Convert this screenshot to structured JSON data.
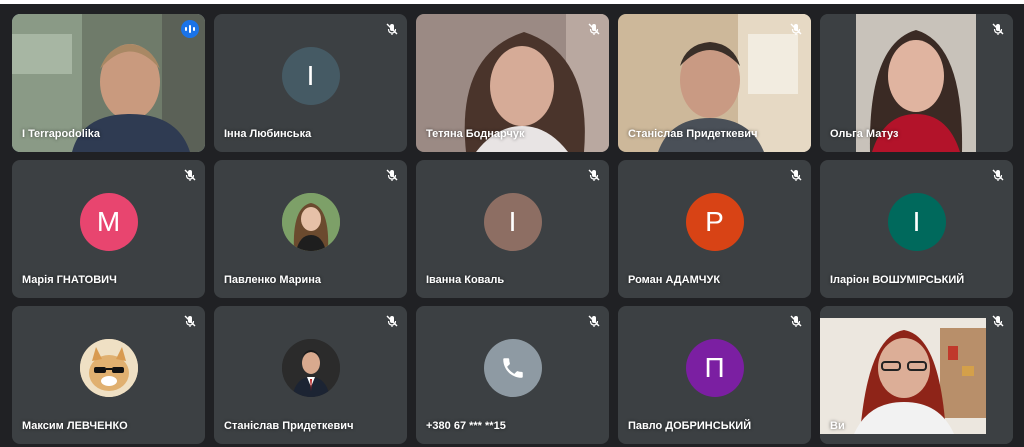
{
  "participants": [
    {
      "name": "I Terrapodolika",
      "kind": "video",
      "speaking": true
    },
    {
      "name": "Інна Любинська",
      "kind": "letter",
      "letter": "I",
      "color": "#455a64"
    },
    {
      "name": "Тетяна Боднарчук",
      "kind": "video"
    },
    {
      "name": "Станіслав Придеткевич",
      "kind": "video"
    },
    {
      "name": "Ольга Матуз",
      "kind": "video"
    },
    {
      "name": "Марія ГНАТОВИЧ",
      "kind": "letter",
      "letter": "M",
      "color": "#e8456f"
    },
    {
      "name": "Павленко Марина",
      "kind": "photo"
    },
    {
      "name": "Іванна Коваль",
      "kind": "letter",
      "letter": "I",
      "color": "#8d6e63"
    },
    {
      "name": "Роман АДАМЧУК",
      "kind": "letter",
      "letter": "P",
      "color": "#d84315"
    },
    {
      "name": "Іларіон ВОШУМІРСЬКИЙ",
      "kind": "letter",
      "letter": "I",
      "color": "#00695c"
    },
    {
      "name": "Максим ЛЕВЧЕНКО",
      "kind": "photo"
    },
    {
      "name": "Станіслав Придеткевич",
      "kind": "photo"
    },
    {
      "name": "+380 67 *** **15",
      "kind": "phone",
      "color": "#8e9aa3"
    },
    {
      "name": "Павло ДОБРИНСЬКИЙ",
      "kind": "letter",
      "letter": "П",
      "color": "#7b1fa2"
    },
    {
      "name": "Ви",
      "kind": "video"
    }
  ],
  "icons": {
    "muted": "mic-off-icon",
    "active_speaker": "audio-level-icon",
    "phone": "phone-icon"
  }
}
